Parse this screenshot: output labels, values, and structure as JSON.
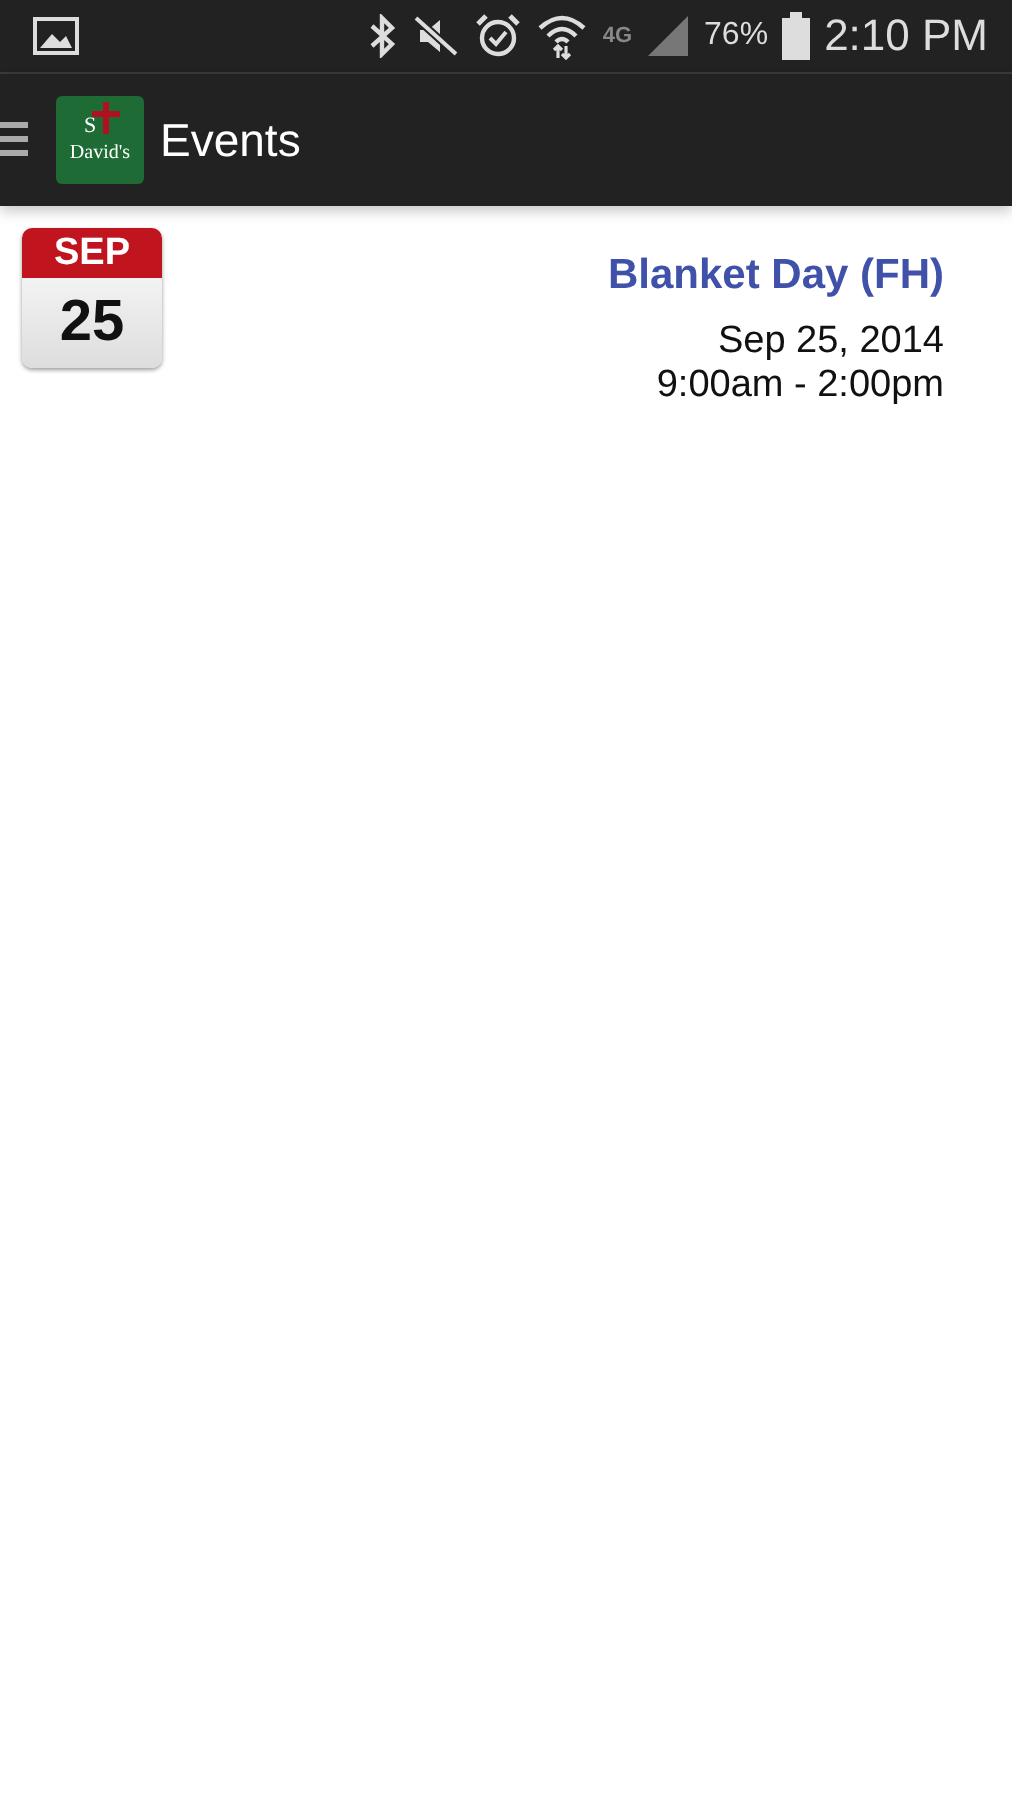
{
  "status_bar": {
    "network": "4G",
    "battery": "76%",
    "time": "2:10 PM"
  },
  "app_bar": {
    "logo": {
      "top": "S",
      "bottom": "David's"
    },
    "title": "Events"
  },
  "events": [
    {
      "month": "SEP",
      "day": "25",
      "title": "Blanket Day (FH)",
      "date": "Sep 25, 2014",
      "time": "9:00am - 2:00pm"
    }
  ]
}
